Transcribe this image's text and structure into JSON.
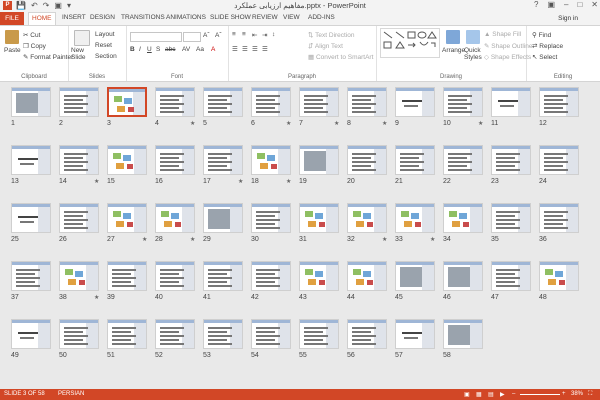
{
  "window": {
    "title": "مفاهیم ارزیابی عملکرد.pptx - PowerPoint",
    "app_icon": "P",
    "sign_in": "Sign in",
    "qat_icons": [
      "save-icon",
      "undo-icon",
      "redo-icon",
      "present-icon",
      "customize-icon"
    ],
    "win_buttons": [
      "?",
      "▣",
      "–",
      "□",
      "✕"
    ]
  },
  "tabs": [
    "FILE",
    "HOME",
    "INSERT",
    "DESIGN",
    "TRANSITIONS",
    "ANIMATIONS",
    "SLIDE SHOW",
    "REVIEW",
    "VIEW",
    "ADD-INS"
  ],
  "active_tab": "HOME",
  "ribbon": {
    "clipboard": {
      "label": "Clipboard",
      "paste": "Paste",
      "cut": "Cut",
      "copy": "Copy",
      "format_painter": "Format Painter"
    },
    "slides": {
      "label": "Slides",
      "new_slide": "New Slide",
      "layout": "Layout",
      "reset": "Reset",
      "section": "Section"
    },
    "font": {
      "label": "Font"
    },
    "paragraph": {
      "label": "Paragraph",
      "text_direction": "Text Direction",
      "align_text": "Align Text",
      "convert_smartart": "Convert to SmartArt"
    },
    "drawing": {
      "label": "Drawing",
      "arrange": "Arrange",
      "quick_styles": "Quick Styles",
      "shape_fill": "Shape Fill",
      "shape_outline": "Shape Outline",
      "shape_effects": "Shape Effects"
    },
    "editing": {
      "label": "Editing",
      "find": "Find",
      "replace": "Replace",
      "select": "Select"
    }
  },
  "slides": [
    {
      "n": "1",
      "star": false,
      "kind": "img"
    },
    {
      "n": "2",
      "star": false,
      "kind": "txt"
    },
    {
      "n": "3",
      "star": false,
      "kind": "diag",
      "selected": true
    },
    {
      "n": "4",
      "star": true,
      "kind": "txt"
    },
    {
      "n": "5",
      "star": false,
      "kind": "txt"
    },
    {
      "n": "6",
      "star": true,
      "kind": "txt"
    },
    {
      "n": "7",
      "star": true,
      "kind": "txt"
    },
    {
      "n": "8",
      "star": true,
      "kind": "txt"
    },
    {
      "n": "9",
      "star": false,
      "kind": "title"
    },
    {
      "n": "10",
      "star": true,
      "kind": "txt"
    },
    {
      "n": "11",
      "star": false,
      "kind": "title"
    },
    {
      "n": "12",
      "star": false,
      "kind": "txt"
    },
    {
      "n": "13",
      "star": false,
      "kind": "title"
    },
    {
      "n": "14",
      "star": true,
      "kind": "txt"
    },
    {
      "n": "15",
      "star": false,
      "kind": "diag"
    },
    {
      "n": "16",
      "star": false,
      "kind": "txt"
    },
    {
      "n": "17",
      "star": true,
      "kind": "txt"
    },
    {
      "n": "18",
      "star": true,
      "kind": "diag"
    },
    {
      "n": "19",
      "star": false,
      "kind": "img"
    },
    {
      "n": "20",
      "star": false,
      "kind": "txt"
    },
    {
      "n": "21",
      "star": false,
      "kind": "txt"
    },
    {
      "n": "22",
      "star": false,
      "kind": "txt"
    },
    {
      "n": "23",
      "star": false,
      "kind": "txt"
    },
    {
      "n": "24",
      "star": false,
      "kind": "txt"
    },
    {
      "n": "25",
      "star": false,
      "kind": "title"
    },
    {
      "n": "26",
      "star": false,
      "kind": "txt"
    },
    {
      "n": "27",
      "star": true,
      "kind": "diag"
    },
    {
      "n": "28",
      "star": true,
      "kind": "diag"
    },
    {
      "n": "29",
      "star": false,
      "kind": "img"
    },
    {
      "n": "30",
      "star": false,
      "kind": "txt"
    },
    {
      "n": "31",
      "star": false,
      "kind": "diag"
    },
    {
      "n": "32",
      "star": true,
      "kind": "diag"
    },
    {
      "n": "33",
      "star": true,
      "kind": "diag"
    },
    {
      "n": "34",
      "star": false,
      "kind": "diag"
    },
    {
      "n": "35",
      "star": false,
      "kind": "txt"
    },
    {
      "n": "36",
      "star": false,
      "kind": "txt"
    },
    {
      "n": "37",
      "star": false,
      "kind": "txt"
    },
    {
      "n": "38",
      "star": true,
      "kind": "diag"
    },
    {
      "n": "39",
      "star": false,
      "kind": "txt"
    },
    {
      "n": "40",
      "star": false,
      "kind": "txt"
    },
    {
      "n": "41",
      "star": false,
      "kind": "txt"
    },
    {
      "n": "42",
      "star": false,
      "kind": "txt"
    },
    {
      "n": "43",
      "star": false,
      "kind": "diag"
    },
    {
      "n": "44",
      "star": false,
      "kind": "diag"
    },
    {
      "n": "45",
      "star": false,
      "kind": "img"
    },
    {
      "n": "46",
      "star": false,
      "kind": "img"
    },
    {
      "n": "47",
      "star": false,
      "kind": "txt"
    },
    {
      "n": "48",
      "star": false,
      "kind": "diag"
    },
    {
      "n": "49",
      "star": false,
      "kind": "title"
    },
    {
      "n": "50",
      "star": false,
      "kind": "txt"
    },
    {
      "n": "51",
      "star": false,
      "kind": "txt"
    },
    {
      "n": "52",
      "star": false,
      "kind": "txt"
    },
    {
      "n": "53",
      "star": false,
      "kind": "txt"
    },
    {
      "n": "54",
      "star": false,
      "kind": "txt"
    },
    {
      "n": "55",
      "star": false,
      "kind": "txt"
    },
    {
      "n": "56",
      "star": false,
      "kind": "txt"
    },
    {
      "n": "57",
      "star": false,
      "kind": "title"
    },
    {
      "n": "58",
      "star": false,
      "kind": "img"
    }
  ],
  "status": {
    "slide_info": "SLIDE 3 OF 58",
    "language": "PERSIAN",
    "zoom": "38%",
    "accent": "#d24726"
  }
}
